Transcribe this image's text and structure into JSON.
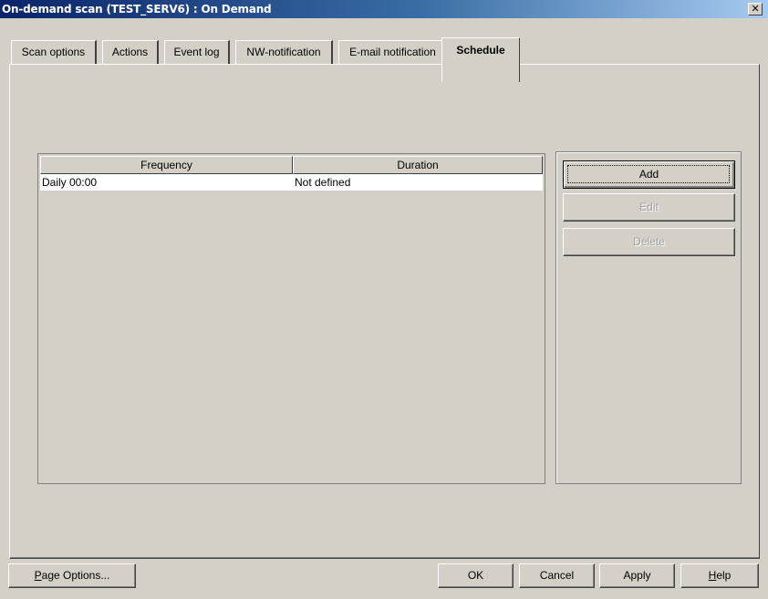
{
  "window": {
    "title": "On-demand scan (TEST_SERV6) : On Demand",
    "close_glyph": "✕"
  },
  "tabs": [
    {
      "label": "Scan options",
      "active": false
    },
    {
      "label": "Actions",
      "active": false
    },
    {
      "label": "Event log",
      "active": false
    },
    {
      "label": "NW-notification",
      "active": false
    },
    {
      "label": "E-mail notification",
      "active": false
    },
    {
      "label": "Schedule",
      "active": true
    }
  ],
  "schedule_table": {
    "columns": [
      "Frequency",
      "Duration"
    ],
    "rows": [
      {
        "frequency": "Daily 00:00",
        "duration": "Not defined"
      }
    ]
  },
  "schedule_buttons": {
    "add": "Add",
    "edit": "Edit",
    "delete": "Delete"
  },
  "footer": {
    "page_options_pre": "",
    "page_options_key": "P",
    "page_options_post": "age Options...",
    "ok": "OK",
    "cancel": "Cancel",
    "apply": "Apply",
    "help_key": "H",
    "help_post": "elp"
  },
  "colors": {
    "titlebar_start": "#0a246a",
    "titlebar_end": "#a6caf0",
    "face": "#d4d0c8",
    "disabled_text": "#a0a0a0"
  }
}
